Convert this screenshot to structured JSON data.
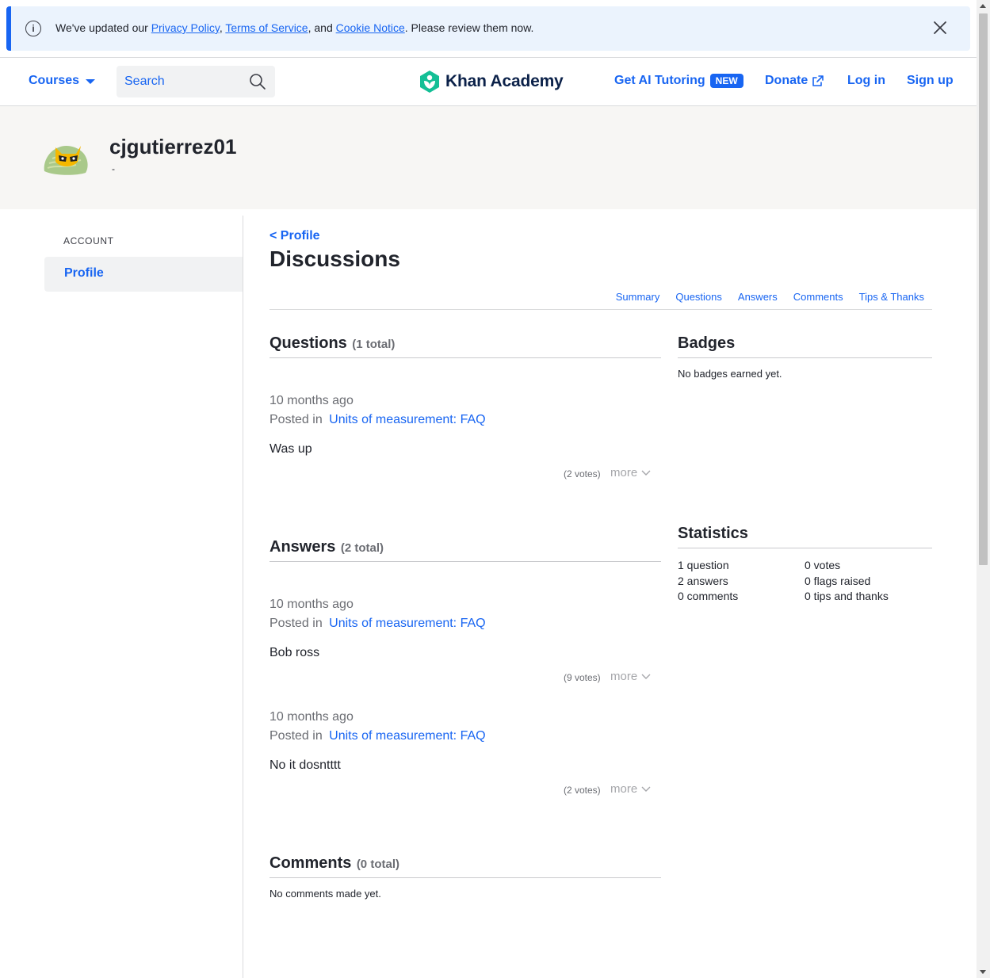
{
  "banner": {
    "text_before": "We've updated our ",
    "privacy_link": "Privacy Policy",
    "sep1": ", ",
    "terms_link": "Terms of Service",
    "sep2": ", and ",
    "cookie_link": "Cookie Notice",
    "text_after": ". Please review them now."
  },
  "header": {
    "courses_label": "Courses",
    "search_placeholder": "Search",
    "logo_text": "Khan Academy",
    "ai_tutoring_label": "Get AI Tutoring",
    "new_badge": "NEW",
    "donate_label": "Donate",
    "login_label": "Log in",
    "signup_label": "Sign up"
  },
  "profile": {
    "username": "cjgutierrez01",
    "bio": "-"
  },
  "sidebar": {
    "section_label": "ACCOUNT",
    "items": [
      {
        "label": "Profile"
      }
    ]
  },
  "main": {
    "back_link": "< Profile",
    "title": "Discussions",
    "subnav": [
      "Summary",
      "Questions",
      "Answers",
      "Comments",
      "Tips & Thanks"
    ]
  },
  "questions": {
    "title": "Questions",
    "count": "(1 total)",
    "posts": [
      {
        "when": "10 months ago",
        "posted_in_label": "Posted in",
        "topic": "Units of measurement: FAQ",
        "body": "Was up",
        "votes": "(2 votes)",
        "more": "more"
      }
    ]
  },
  "answers": {
    "title": "Answers",
    "count": "(2 total)",
    "posts": [
      {
        "when": "10 months ago",
        "posted_in_label": "Posted in",
        "topic": "Units of measurement: FAQ",
        "body": "Bob ross",
        "votes": "(9 votes)",
        "more": "more"
      },
      {
        "when": "10 months ago",
        "posted_in_label": "Posted in",
        "topic": "Units of measurement: FAQ",
        "body": "No it dosntttt",
        "votes": "(2 votes)",
        "more": "more"
      }
    ]
  },
  "comments": {
    "title": "Comments",
    "count": "(0 total)",
    "empty": "No comments made yet."
  },
  "badges": {
    "title": "Badges",
    "empty": "No badges earned yet."
  },
  "statistics": {
    "title": "Statistics",
    "left": [
      "1 question",
      "2 answers",
      "0 comments"
    ],
    "right": [
      "0 votes",
      "0 flags raised",
      "0 tips and thanks"
    ]
  },
  "colors": {
    "accent": "#1865f2",
    "banner_bg": "#ebf3fd",
    "profile_bg": "#f7f6f4",
    "logo_green": "#14bf96"
  }
}
